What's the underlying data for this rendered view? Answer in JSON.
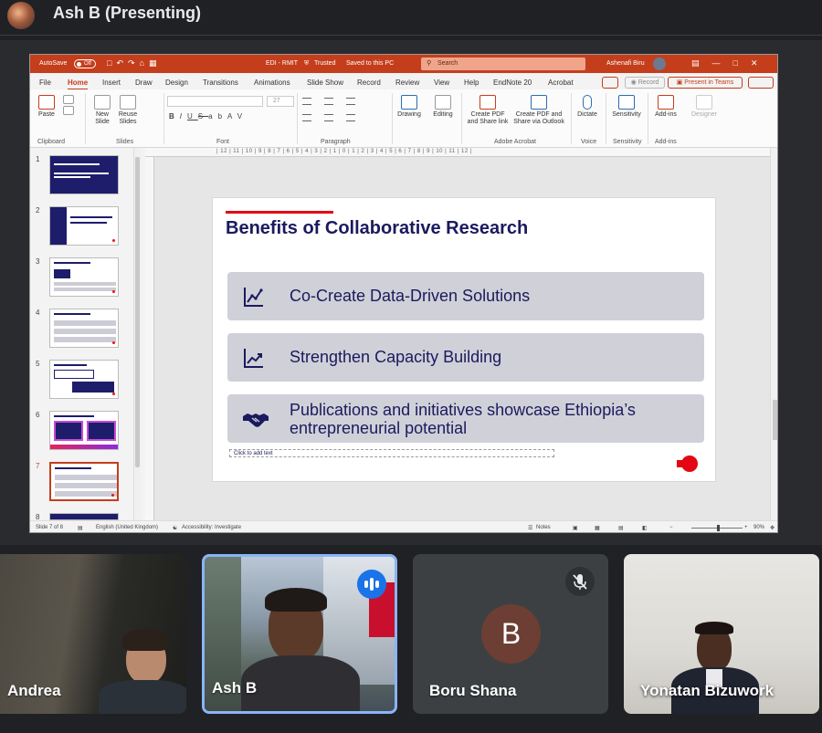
{
  "meeting": {
    "presenter_label": "Ash B (Presenting)"
  },
  "ppt": {
    "titlebar": {
      "autosave_label": "AutoSave",
      "autosave_state": "Off",
      "file_name": "EDI - RMIT",
      "trusted_label": "Trusted",
      "saved_status": "Saved to this PC",
      "search_placeholder": "Search",
      "user_name": "Ashenafi Biru"
    },
    "menu": [
      "File",
      "Home",
      "Insert",
      "Draw",
      "Design",
      "Transitions",
      "Animations",
      "Slide Show",
      "Record",
      "Review",
      "View",
      "Help",
      "EndNote 20",
      "Acrobat"
    ],
    "active_menu": "Home",
    "record_label": "Record",
    "present_label": "Present in Teams",
    "ribbon": {
      "paste": "Paste",
      "new_slide": "New\nSlide",
      "reuse_slides": "Reuse\nSlides",
      "drawing": "Drawing",
      "editing": "Editing",
      "create_pdf": "Create PDF\nand Share link",
      "create_pdf_outlook": "Create PDF and\nShare via Outlook",
      "dictate": "Dictate",
      "sensitivity": "Sensitivity",
      "addins": "Add-ins",
      "designer": "Designer",
      "font_size": "27",
      "groups": {
        "clipboard": "Clipboard",
        "slides": "Slides",
        "font": "Font",
        "paragraph": "Paragraph",
        "acrobat": "Adobe Acrobat",
        "voice": "Voice",
        "sensitivity": "Sensitivity",
        "addins": "Add-ins"
      }
    },
    "ruler_ticks": "| 12 | 11 | 10 | 9 | 8 | 7 | 6 | 5 | 4 | 3 | 2 | 1 | 0 | 1 | 2 | 3 | 4 | 5 | 6 | 7 | 8 | 9 | 10 | 11 | 12 |",
    "thumbnails": [
      "1",
      "2",
      "3",
      "4",
      "5",
      "6",
      "7",
      "8"
    ],
    "selected_slide": 7,
    "slide": {
      "title": "Benefits of Collaborative Research",
      "items": [
        {
          "text": "Co-Create Data-Driven Solutions",
          "icon": "chart-line-icon"
        },
        {
          "text": "Strengthen Capacity Building",
          "icon": "trend-up-icon"
        },
        {
          "text": "Publications and initiatives showcase Ethiopia’s entrepreneurial potential",
          "icon": "handshake-icon"
        }
      ],
      "placeholder": "Click to add text"
    },
    "status": {
      "slide_count": "Slide 7 of 8",
      "language": "English (United Kingdom)",
      "accessibility": "Accessibility: Investigate",
      "notes": "Notes",
      "zoom": "90%"
    }
  },
  "participants": [
    {
      "name": "Andrea"
    },
    {
      "name": "Ash B",
      "speaking": true
    },
    {
      "name": "Boru Shana",
      "initial": "B",
      "muted": true,
      "avatar_color": "#6d3e33"
    },
    {
      "name": "Yonatan Bizuwork"
    }
  ],
  "colors": {
    "ppt_accent": "#c43e1c",
    "slide_navy": "#1a1a5e",
    "slide_red": "#e30613",
    "speaking_ring": "#8ab4f8"
  }
}
